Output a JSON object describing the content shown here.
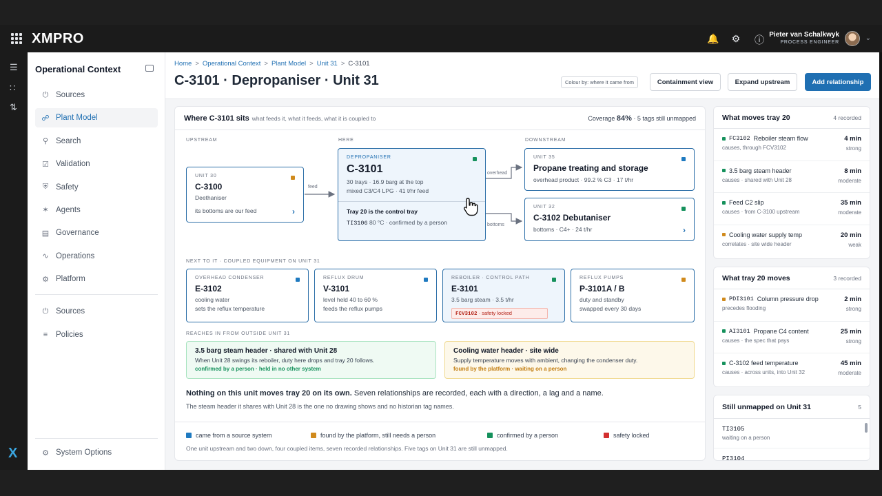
{
  "app": {
    "logo": "XMPRO",
    "user_name": "Pieter van Schalkwyk",
    "user_role": "PROCESS ENGINEER"
  },
  "sidebar": {
    "title": "Operational Context",
    "items": [
      {
        "label": "Sources",
        "icon": "plug-icon"
      },
      {
        "label": "Plant Model",
        "icon": "hierarchy-icon",
        "active": true
      },
      {
        "label": "Search",
        "icon": "search-icon"
      },
      {
        "label": "Validation",
        "icon": "checkbox-icon"
      },
      {
        "label": "Safety",
        "icon": "shield-icon"
      },
      {
        "label": "Agents",
        "icon": "agent-icon"
      },
      {
        "label": "Governance",
        "icon": "document-icon"
      },
      {
        "label": "Operations",
        "icon": "pulse-icon"
      },
      {
        "label": "Platform",
        "icon": "gear-icon"
      }
    ],
    "items2": [
      {
        "label": "Sources",
        "icon": "plug-icon"
      },
      {
        "label": "Policies",
        "icon": "lines-icon"
      }
    ],
    "bottom": "System Options"
  },
  "header": {
    "breadcrumbs": [
      "Home",
      "Operational Context",
      "Plant Model",
      "Unit 31",
      "C-3101"
    ],
    "title": "C-3101 · Depropaniser · Unit 31",
    "colour_by": "Colour by: where it came from",
    "btn_containment": "Containment view",
    "btn_expand": "Expand upstream",
    "btn_add": "Add relationship"
  },
  "colors": {
    "source": "#1f7ac0",
    "platform": "#d08a1c",
    "person": "#15915c",
    "locked": "#d32f2f"
  },
  "main": {
    "title": "Where C-3101 sits",
    "subtitle": "what feeds it, what it feeds, what it is coupled to",
    "coverage_label": "Coverage",
    "coverage_pct": "84%",
    "coverage_rest": "· 5 tags still unmapped",
    "upstream_label": "UPSTREAM",
    "here_label": "HERE",
    "downstream_label": "DOWNSTREAM",
    "upstream": {
      "kicker": "UNIT 30",
      "name": "C-3100",
      "desc": "Deethaniser",
      "note": "its bottoms are our feed"
    },
    "feed_label": "feed",
    "here": {
      "kicker": "DEPROPANISER",
      "name": "C-3101",
      "line1": "30 trays · 16.9 barg at the top",
      "line2": "mixed C3/C4 LPG · 41 t/hr feed",
      "control": "Tray 20 is the control tray",
      "tag": "TI3106",
      "tag_note": "80 °C · confirmed by a person"
    },
    "overhead_label": "overhead",
    "bottoms_label": "bottoms",
    "down1": {
      "kicker": "UNIT 35",
      "name": "Propane treating and storage",
      "desc": "overhead product · 99.2 % C3 · 17 t/hr"
    },
    "down2": {
      "kicker": "UNIT 32",
      "name": "C-3102 Debutaniser",
      "desc": "bottoms · C4+ · 24 t/hr"
    },
    "coupled_label": "NEXT TO IT · COUPLED EQUIPMENT ON UNIT 31",
    "coupled": [
      {
        "kicker": "OVERHEAD CONDENSER",
        "name": "E-3102",
        "l1": "cooling water",
        "l2": "sets the reflux temperature"
      },
      {
        "kicker": "REFLUX DRUM",
        "name": "V-3101",
        "l1": "level held 40 to 60 %",
        "l2": "feeds the reflux pumps"
      },
      {
        "kicker": "REBOILER · CONTROL PATH",
        "name": "E-3101",
        "l1": "3.5 barg steam · 3.5 t/hr",
        "tag": "FCV3102",
        "tag_note": "· safety locked"
      },
      {
        "kicker": "REFLUX PUMPS",
        "name": "P-3101A / B",
        "l1": "duty and standby",
        "l2": "swapped every 30 days"
      }
    ],
    "reaches_label": "REACHES IN FROM OUTSIDE UNIT 31",
    "reach1": {
      "title": "3.5 barg steam header · shared with Unit 28",
      "desc": "When Unit 28 swings its reboiler, duty here drops and tray 20 follows.",
      "status": "confirmed by a person · held in no other system"
    },
    "reach2": {
      "title": "Cooling water header · site wide",
      "desc": "Supply temperature moves with ambient, changing the condenser duty.",
      "status": "found by the platform · waiting on a person"
    },
    "summary_bold": "Nothing on this unit moves tray 20 on its own.",
    "summary_rest": " Seven relationships are recorded, each with a direction, a lag and a name.",
    "summary2": "The steam header it shares with Unit 28 is the one no drawing shows and no historian tag names.",
    "legend": {
      "source": "came from a source system",
      "platform": "found by the platform, still needs a person",
      "person": "confirmed by a person",
      "locked": "safety locked"
    },
    "footer": "One unit upstream and two down, four coupled items, seven recorded relationships. Five tags on Unit 31 are still unmapped."
  },
  "moves_tray": {
    "title": "What moves tray 20",
    "count": "4 recorded",
    "rows": [
      {
        "tag": "FC3102",
        "name": "Reboiler steam flow",
        "sub": "causes, through FCV3102",
        "lag": "4 min",
        "strength": "strong",
        "color": "#15915c"
      },
      {
        "tag": "",
        "name": "3.5 barg steam header",
        "sub": "causes · shared with Unit 28",
        "lag": "8 min",
        "strength": "moderate",
        "color": "#15915c"
      },
      {
        "tag": "",
        "name": "Feed C2 slip",
        "sub": "causes · from C-3100 upstream",
        "lag": "35 min",
        "strength": "moderate",
        "color": "#15915c"
      },
      {
        "tag": "",
        "name": "Cooling water supply temp",
        "sub": "correlates · site wide header",
        "lag": "20 min",
        "strength": "weak",
        "color": "#d08a1c"
      }
    ]
  },
  "tray_moves": {
    "title": "What tray 20 moves",
    "count": "3 recorded",
    "rows": [
      {
        "tag": "PDI3101",
        "name": "Column pressure drop",
        "sub": "precedes flooding",
        "lag": "2 min",
        "strength": "strong",
        "color": "#d08a1c"
      },
      {
        "tag": "AI3101",
        "name": "Propane C4 content",
        "sub": "causes · the spec that pays",
        "lag": "25 min",
        "strength": "strong",
        "color": "#15915c"
      },
      {
        "tag": "",
        "name": "C-3102 feed temperature",
        "sub": "causes · across units, into Unit 32",
        "lag": "45 min",
        "strength": "moderate",
        "color": "#15915c"
      }
    ]
  },
  "unmapped": {
    "title": "Still unmapped on Unit 31",
    "count": "5",
    "rows": [
      {
        "tag": "TI3105",
        "sub": "waiting on a person"
      },
      {
        "tag": "PI3104",
        "sub": ""
      }
    ]
  }
}
